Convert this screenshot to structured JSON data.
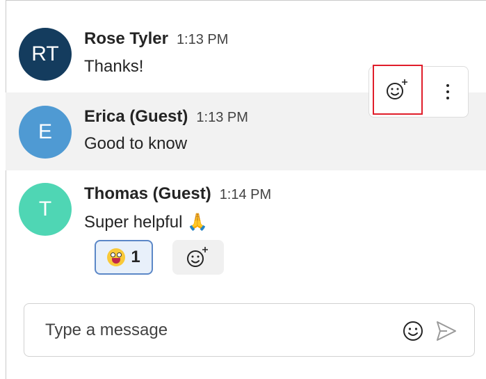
{
  "messages": [
    {
      "initials": "RT",
      "author": "Rose Tyler",
      "time": "1:13 PM",
      "text": "Thanks!",
      "avatar_color": "#143c5e"
    },
    {
      "initials": "E",
      "author": "Erica (Guest)",
      "time": "1:13 PM",
      "text": "Good to know",
      "avatar_color": "#4f9ad3"
    },
    {
      "initials": "T",
      "author": "Thomas (Guest)",
      "time": "1:14 PM",
      "text": "Super helpful",
      "text_emoji": "🙏",
      "avatar_color": "#4fd6b4",
      "reactions": [
        {
          "icon": "grinning-face-emoji-icon",
          "count": "1"
        }
      ]
    }
  ],
  "hover_toolbar": {
    "add_reaction_icon": "smiley-plus-icon",
    "more_icon": "vertical-ellipsis-icon",
    "highlight_color": "#e01d2a"
  },
  "composer": {
    "placeholder": "Type a message",
    "value": "",
    "emoji_icon": "smiley-icon",
    "send_icon": "send-icon"
  }
}
